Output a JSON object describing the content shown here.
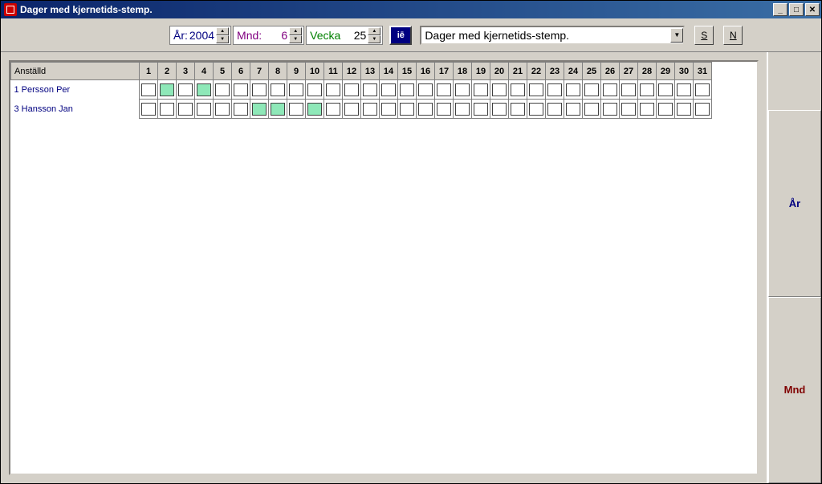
{
  "window": {
    "title": "Dager med kjernetids-stemp."
  },
  "toolbar": {
    "year_label": "År:",
    "year_value": "2004",
    "month_label": "Mnd:",
    "month_value": "6",
    "week_label": "Vecka",
    "week_value": "25",
    "dropdown_value": "Dager med kjernetids-stemp.",
    "btn_s": "S",
    "btn_n": "N"
  },
  "side": {
    "year": "År",
    "month": "Mnd"
  },
  "grid": {
    "emp_header": "Anställd",
    "days": [
      "1",
      "2",
      "3",
      "4",
      "5",
      "6",
      "7",
      "8",
      "9",
      "10",
      "11",
      "12",
      "13",
      "14",
      "15",
      "16",
      "17",
      "18",
      "19",
      "20",
      "21",
      "22",
      "23",
      "24",
      "25",
      "26",
      "27",
      "28",
      "29",
      "30",
      "31"
    ],
    "rows": [
      {
        "name": "1 Persson Per",
        "marked": [
          2,
          4
        ]
      },
      {
        "name": "3 Hansson Jan",
        "marked": [
          7,
          8,
          10
        ]
      }
    ]
  }
}
